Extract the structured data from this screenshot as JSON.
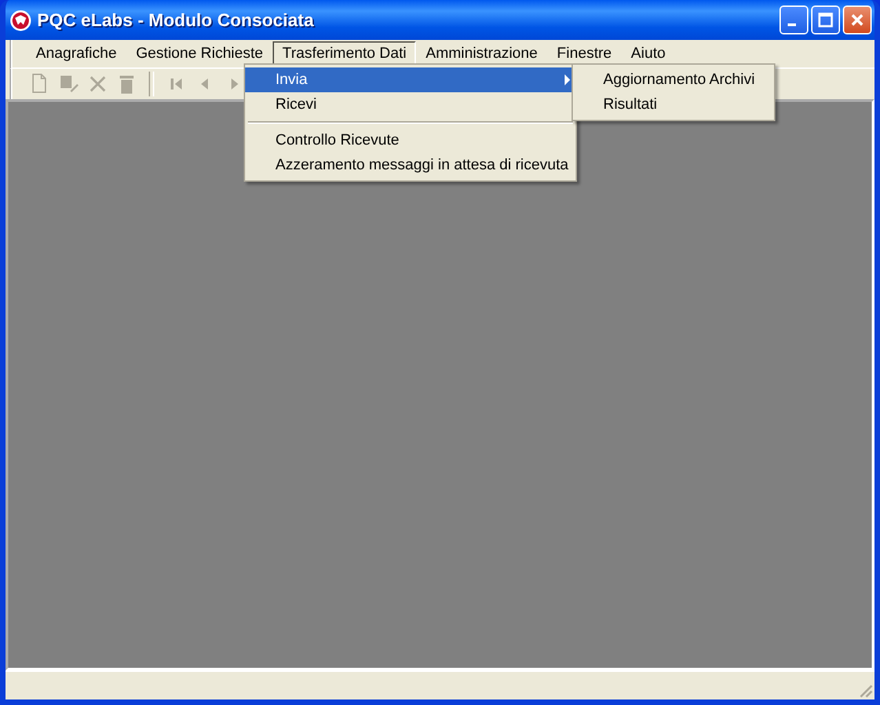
{
  "window": {
    "title": "PQC eLabs - Modulo Consociata"
  },
  "menu_bar": [
    {
      "label": "Anagrafiche",
      "selected": false
    },
    {
      "label": "Gestione Richieste",
      "selected": false
    },
    {
      "label": "Trasferimento Dati",
      "selected": true
    },
    {
      "label": "Amministrazione",
      "selected": false
    },
    {
      "label": "Finestre",
      "selected": false
    },
    {
      "label": "Aiuto",
      "selected": false
    }
  ],
  "toolbar": [
    {
      "kind": "new",
      "disabled": true
    },
    {
      "kind": "edit",
      "disabled": true
    },
    {
      "kind": "delete",
      "disabled": true
    },
    {
      "kind": "trash",
      "disabled": true
    },
    {
      "kind": "separator"
    },
    {
      "kind": "first",
      "disabled": true
    },
    {
      "kind": "previous",
      "disabled": true
    },
    {
      "kind": "next",
      "disabled": true
    }
  ],
  "dropdown": {
    "items": [
      {
        "kind": "item",
        "label": "Invia",
        "selected": true,
        "submenu": true
      },
      {
        "kind": "item",
        "label": "Ricevi",
        "selected": false,
        "submenu": false
      },
      {
        "kind": "separator"
      },
      {
        "kind": "item",
        "label": "Controllo Ricevute",
        "selected": false,
        "submenu": false
      },
      {
        "kind": "item",
        "label": "Azzeramento messaggi in attesa di ricevuta",
        "selected": false,
        "submenu": false
      }
    ]
  },
  "submenu": {
    "items": [
      {
        "label": "Aggiornamento Archivi",
        "selected": false
      },
      {
        "label": "Risultati",
        "selected": false
      }
    ]
  }
}
